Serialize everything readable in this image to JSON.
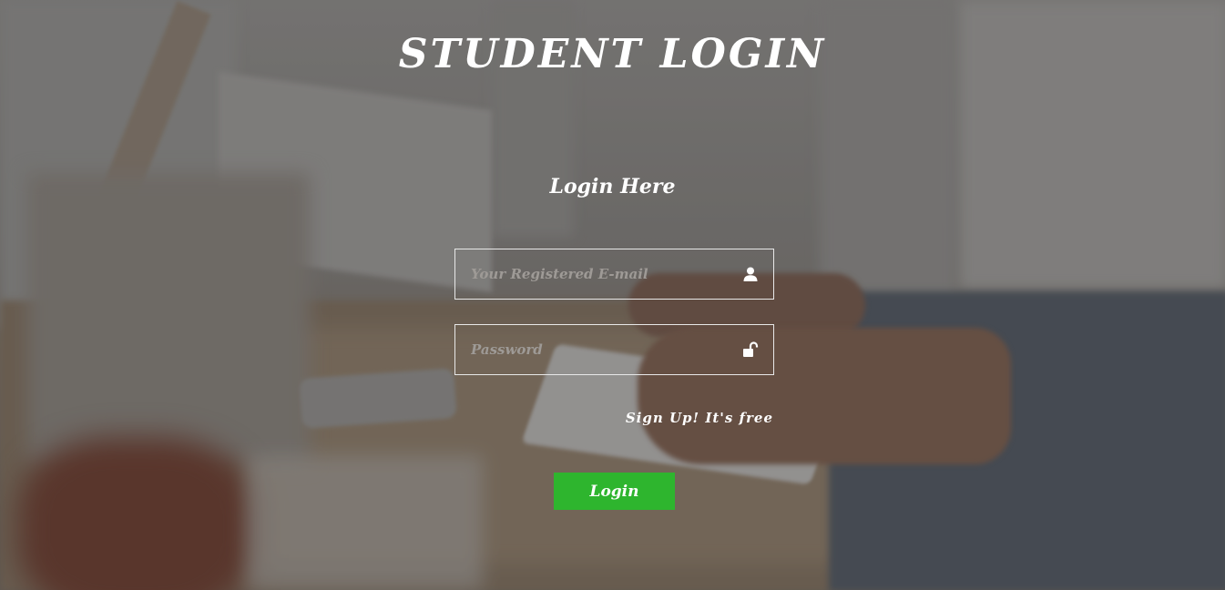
{
  "page": {
    "title": "STUDENT LOGIN"
  },
  "login_form": {
    "heading": "Login Here",
    "email_field": {
      "placeholder": "Your Registered E-mail",
      "value": "",
      "icon": "user-icon"
    },
    "password_field": {
      "placeholder": "Password",
      "value": "",
      "icon": "unlock-icon"
    },
    "signup_link": "Sign Up! It's free",
    "submit_label": "Login"
  },
  "colors": {
    "button_bg": "#2eb52e",
    "text": "#ffffff",
    "field_border": "#e8e8e8",
    "placeholder": "#9e9a96"
  }
}
